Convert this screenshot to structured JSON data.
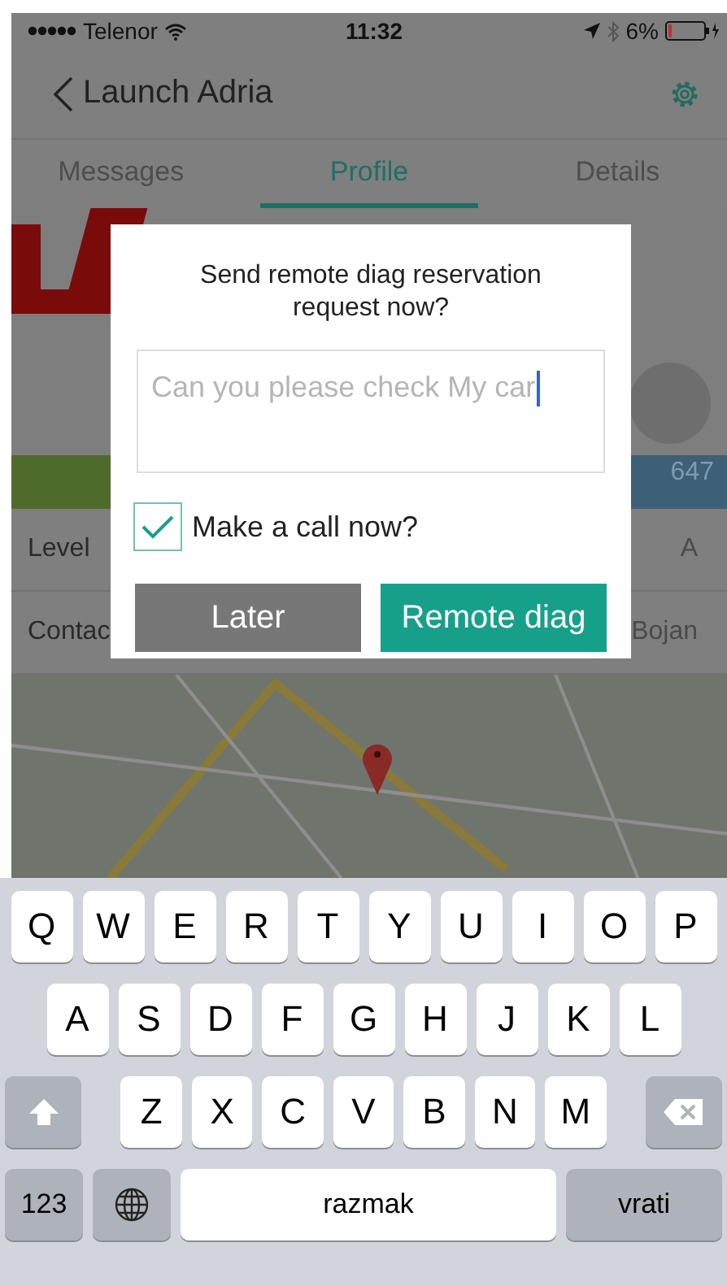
{
  "status_bar": {
    "carrier": "Telenor",
    "time": "11:32",
    "battery": "6%"
  },
  "nav": {
    "title": "Launch Adria"
  },
  "tabs": [
    {
      "label": "Messages",
      "selected": false
    },
    {
      "label": "Profile",
      "selected": true
    },
    {
      "label": "Details",
      "selected": false
    }
  ],
  "profile": {
    "banner_value": "647",
    "rows": [
      {
        "label": "Level",
        "value": "A"
      },
      {
        "label": "Contac",
        "value": "Bojan"
      }
    ]
  },
  "dialog": {
    "title": "Send remote diag reservation request now?",
    "message": "Can you please check My car",
    "checkbox": {
      "label": "Make a call now?",
      "checked": true
    },
    "buttons": [
      {
        "label": "Later",
        "kind": "secondary"
      },
      {
        "label": "Remote diag",
        "kind": "primary"
      }
    ]
  },
  "keyboard": {
    "rows": [
      {
        "keys": [
          {
            "kind": "char",
            "label": "Q"
          },
          {
            "kind": "char",
            "label": "W"
          },
          {
            "kind": "char",
            "label": "E"
          },
          {
            "kind": "char",
            "label": "R"
          },
          {
            "kind": "char",
            "label": "T"
          },
          {
            "kind": "char",
            "label": "Y"
          },
          {
            "kind": "char",
            "label": "U"
          },
          {
            "kind": "char",
            "label": "I"
          },
          {
            "kind": "char",
            "label": "O"
          },
          {
            "kind": "char",
            "label": "P"
          }
        ]
      },
      {
        "keys": [
          {
            "kind": "char",
            "label": "A"
          },
          {
            "kind": "char",
            "label": "S"
          },
          {
            "kind": "char",
            "label": "D"
          },
          {
            "kind": "char",
            "label": "F"
          },
          {
            "kind": "char",
            "label": "G"
          },
          {
            "kind": "char",
            "label": "H"
          },
          {
            "kind": "char",
            "label": "J"
          },
          {
            "kind": "char",
            "label": "K"
          },
          {
            "kind": "char",
            "label": "L"
          }
        ]
      },
      {
        "keys": [
          {
            "kind": "shift"
          },
          {
            "kind": "char",
            "label": "Z"
          },
          {
            "kind": "char",
            "label": "X"
          },
          {
            "kind": "char",
            "label": "C"
          },
          {
            "kind": "char",
            "label": "V"
          },
          {
            "kind": "char",
            "label": "B"
          },
          {
            "kind": "char",
            "label": "N"
          },
          {
            "kind": "char",
            "label": "M"
          },
          {
            "kind": "backspace"
          }
        ]
      },
      {
        "keys": [
          {
            "kind": "mode",
            "label": "123"
          },
          {
            "kind": "globe"
          },
          {
            "kind": "space",
            "label": "razmak"
          },
          {
            "kind": "return",
            "label": "vrati"
          }
        ]
      }
    ]
  }
}
